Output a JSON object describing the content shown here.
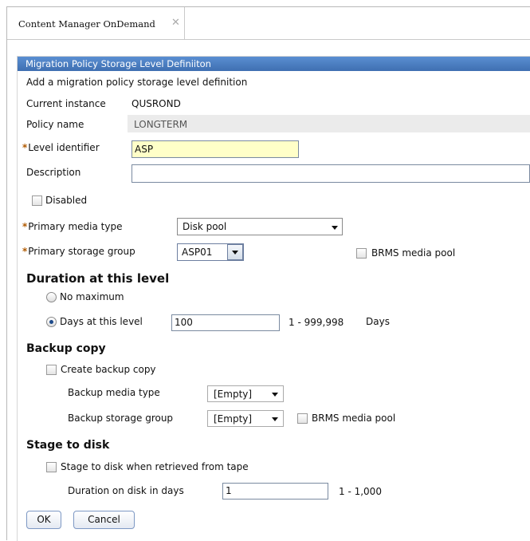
{
  "tab": {
    "title": "Content Manager OnDemand",
    "close": "✕"
  },
  "dialog": {
    "title": "Migration Policy Storage Level Definiiton",
    "subtitle": "Add a migration policy storage level definition"
  },
  "current_instance": {
    "label": "Current instance",
    "value": "QUSROND"
  },
  "policy_name": {
    "label": "Policy name",
    "value": "LONGTERM"
  },
  "level_identifier": {
    "label": "Level identifier",
    "value": "ASP",
    "required_marker": "*"
  },
  "description": {
    "label": "Description",
    "value": ""
  },
  "disabled": {
    "label": "Disabled",
    "checked": false
  },
  "primary_media_type": {
    "label": "Primary media type",
    "value": "Disk pool",
    "required_marker": "*"
  },
  "primary_storage_group": {
    "label": "Primary storage group",
    "value": "ASP01",
    "required_marker": "*"
  },
  "brms_media_pool_primary": {
    "label": "BRMS media pool",
    "checked": false
  },
  "duration": {
    "heading": "Duration at this level",
    "no_maximum": {
      "label": "No maximum",
      "selected": false
    },
    "days": {
      "label": "Days at this level",
      "value": "100",
      "range": "1 - 999,998",
      "unit": "Days",
      "selected": true
    }
  },
  "backup": {
    "heading": "Backup copy",
    "create": {
      "label": "Create backup copy",
      "checked": false
    },
    "media_type": {
      "label": "Backup media type",
      "value": "[Empty]"
    },
    "storage_group": {
      "label": "Backup storage group",
      "value": "[Empty]"
    },
    "brms": {
      "label": "BRMS media pool",
      "checked": false
    }
  },
  "stage": {
    "heading": "Stage to disk",
    "when": {
      "label": "Stage to disk when retrieved from tape",
      "checked": false
    },
    "duration": {
      "label": "Duration on disk in days",
      "value": "1",
      "range": "1 - 1,000"
    }
  },
  "buttons": {
    "ok": "OK",
    "cancel": "Cancel"
  },
  "colors": {
    "title_bar": "#4a7cc0",
    "required_input_bg": "#ffffc8",
    "required_marker": "#b05a00"
  }
}
